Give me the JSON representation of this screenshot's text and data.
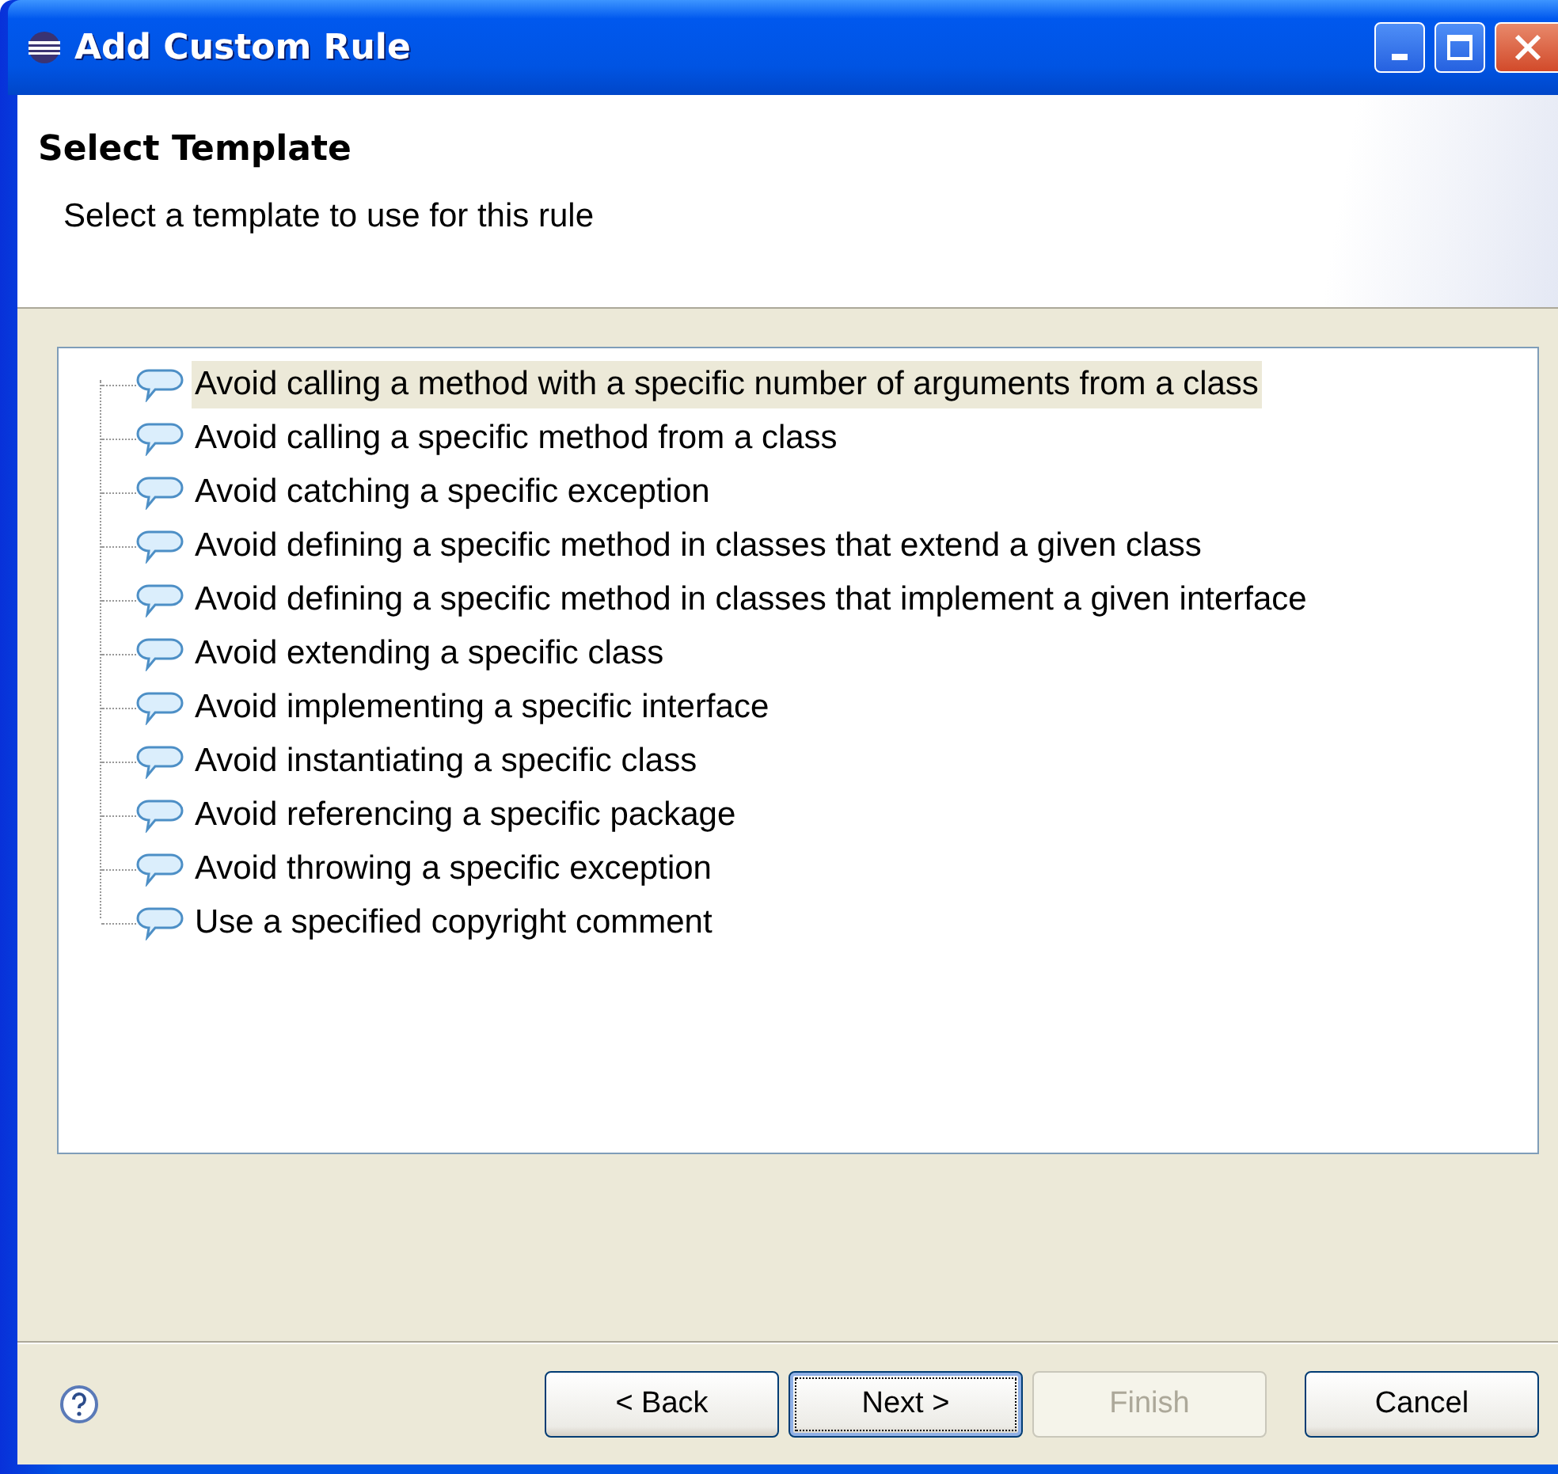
{
  "window": {
    "title": "Add Custom Rule"
  },
  "header": {
    "title": "Select Template",
    "description": "Select a template to use for this rule"
  },
  "templates": [
    {
      "label": "Avoid calling a method with a specific number of arguments from a class",
      "selected": true
    },
    {
      "label": "Avoid calling a specific method from a class",
      "selected": false
    },
    {
      "label": "Avoid catching a specific exception",
      "selected": false
    },
    {
      "label": "Avoid defining a specific method in classes that extend a given class",
      "selected": false
    },
    {
      "label": "Avoid defining a specific method in classes that implement a given interface",
      "selected": false
    },
    {
      "label": "Avoid extending a specific class",
      "selected": false
    },
    {
      "label": "Avoid implementing a specific interface",
      "selected": false
    },
    {
      "label": "Avoid instantiating a specific class",
      "selected": false
    },
    {
      "label": "Avoid referencing a specific package",
      "selected": false
    },
    {
      "label": "Avoid throwing a specific exception",
      "selected": false
    },
    {
      "label": "Use a specified copyright comment",
      "selected": false
    }
  ],
  "buttons": [
    {
      "label": "< Back",
      "disabled": false,
      "default": false
    },
    {
      "label": "Next >",
      "disabled": false,
      "default": true
    },
    {
      "label": "Finish",
      "disabled": true,
      "default": false
    },
    {
      "label": "Cancel",
      "disabled": false,
      "default": false
    }
  ]
}
